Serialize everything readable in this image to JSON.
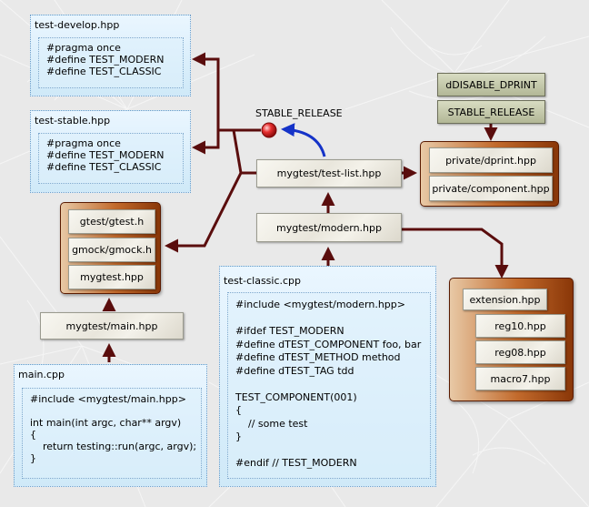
{
  "notes": {
    "test_develop": {
      "title": "test-develop.hpp",
      "code": "#pragma once\n#define TEST_MODERN\n#define TEST_CLASSIC"
    },
    "test_stable": {
      "title": "test-stable.hpp",
      "code": "#pragma once\n#define TEST_MODERN\n#define TEST_CLASSIC"
    },
    "main_cpp": {
      "title": "main.cpp",
      "code": "#include <mygtest/main.hpp>\n\nint main(int argc, char** argv)\n{\n    return testing::run(argc, argv);\n}"
    },
    "test_classic": {
      "title": "test-classic.cpp",
      "code": "#include <mygtest/modern.hpp>\n\n#ifdef TEST_MODERN\n#define dTEST_COMPONENT foo, bar\n#define dTEST_METHOD method\n#define dTEST_TAG tdd\n\nTEST_COMPONENT(001)\n{\n    // some test\n}\n\n#endif // TEST_MODERN"
    }
  },
  "gtest_group": {
    "gtest": "gtest/gtest.h",
    "gmock": "gmock/gmock.h",
    "mygtest": "mygtest.hpp"
  },
  "files": {
    "mygtest_main": "mygtest/main.hpp",
    "test_list": "mygtest/test-list.hpp",
    "modern": "mygtest/modern.hpp"
  },
  "private_group": {
    "dprint": "private/dprint.hpp",
    "component": "private/component.hpp"
  },
  "macros": {
    "ddisable": "dDISABLE_DPRINT",
    "stable_release": "STABLE_RELEASE"
  },
  "stable_label": "STABLE_RELEASE",
  "extension_group": {
    "extension": "extension.hpp",
    "reg10": "reg10.hpp",
    "reg08": "reg08.hpp",
    "macro7": "macro7.hpp"
  },
  "colors": {
    "arrow": "#5a0d0d",
    "switch_arrow": "#1533c8",
    "switch_node": "#d01c1c"
  }
}
